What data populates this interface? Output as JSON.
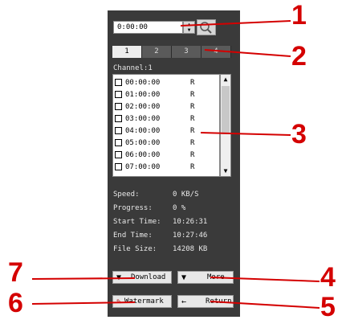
{
  "time_input": {
    "value": "0:00:00"
  },
  "tabs": [
    "1",
    "2",
    "3",
    "4"
  ],
  "channel_label": "Channel:1",
  "recordings": [
    {
      "time": "00:00:00",
      "type": "R"
    },
    {
      "time": "01:00:00",
      "type": "R"
    },
    {
      "time": "02:00:00",
      "type": "R"
    },
    {
      "time": "03:00:00",
      "type": "R"
    },
    {
      "time": "04:00:00",
      "type": "R"
    },
    {
      "time": "05:00:00",
      "type": "R"
    },
    {
      "time": "06:00:00",
      "type": "R"
    },
    {
      "time": "07:00:00",
      "type": "R"
    }
  ],
  "stats": {
    "speed_label": "Speed:",
    "speed": "0 KB/S",
    "progress_label": "Progress:",
    "progress": "0 %",
    "start_label": "Start Time:",
    "start": "10:26:31",
    "end_label": "End Time:",
    "end": "10:27:46",
    "size_label": "File Size:",
    "size": "14208 KB"
  },
  "buttons": {
    "download": "Download",
    "more": "More",
    "watermark": "Watermark",
    "return": "Return"
  },
  "callouts": [
    "1",
    "2",
    "3",
    "4",
    "5",
    "6",
    "7"
  ],
  "colors": {
    "panel": "#3a3a3a",
    "callout": "#d40000"
  }
}
